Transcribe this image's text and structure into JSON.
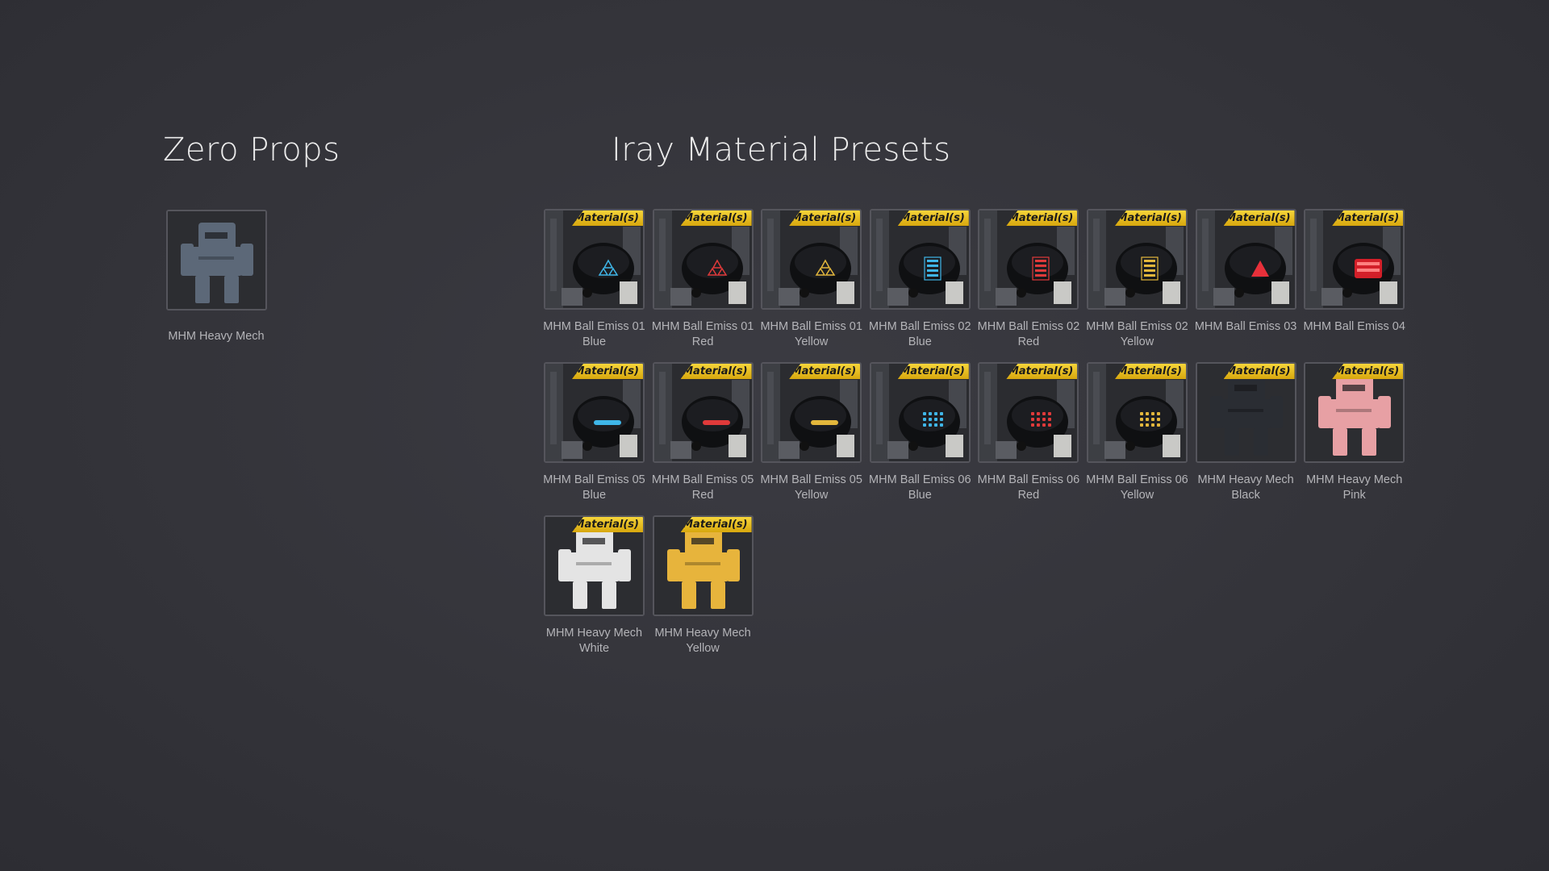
{
  "zero_props": {
    "title": "Zero Props",
    "items": [
      {
        "label": "MHM Heavy Mech",
        "icon": "heavy-mech-icon"
      }
    ]
  },
  "iray_presets": {
    "title": "Iray Material Presets",
    "badge": "Material(s)",
    "items": [
      {
        "label": "MHM Ball Emiss 01 Blue",
        "icon": "ball-emiss-01-icon",
        "accent": "#3fb6e8"
      },
      {
        "label": "MHM Ball Emiss 01 Red",
        "icon": "ball-emiss-01-icon",
        "accent": "#e03a3a"
      },
      {
        "label": "MHM Ball Emiss 01 Yellow",
        "icon": "ball-emiss-01-icon",
        "accent": "#e3b73c"
      },
      {
        "label": "MHM Ball Emiss 02 Blue",
        "icon": "ball-emiss-02-icon",
        "accent": "#3fb6e8"
      },
      {
        "label": "MHM Ball Emiss 02 Red",
        "icon": "ball-emiss-02-icon",
        "accent": "#e03a3a"
      },
      {
        "label": "MHM Ball Emiss 02 Yellow",
        "icon": "ball-emiss-02-icon",
        "accent": "#e3b73c"
      },
      {
        "label": "MHM Ball Emiss 03",
        "icon": "ball-emiss-03-icon",
        "accent": "#e8303a"
      },
      {
        "label": "MHM Ball Emiss 04",
        "icon": "ball-emiss-04-icon",
        "accent": "#e8202a"
      },
      {
        "label": "MHM Ball Emiss 05 Blue",
        "icon": "ball-emiss-05-icon",
        "accent": "#3fb6e8"
      },
      {
        "label": "MHM Ball Emiss 05 Red",
        "icon": "ball-emiss-05-icon",
        "accent": "#e03a3a"
      },
      {
        "label": "MHM Ball Emiss 05 Yellow",
        "icon": "ball-emiss-05-icon",
        "accent": "#e3b73c"
      },
      {
        "label": "MHM Ball Emiss 06 Blue",
        "icon": "ball-emiss-06-icon",
        "accent": "#3fb6e8"
      },
      {
        "label": "MHM Ball Emiss 06 Red",
        "icon": "ball-emiss-06-icon",
        "accent": "#e03a3a"
      },
      {
        "label": "MHM Ball Emiss 06 Yellow",
        "icon": "ball-emiss-06-icon",
        "accent": "#e3b73c"
      },
      {
        "label": "MHM Heavy Mech Black",
        "icon": "heavy-mech-icon",
        "accent": "#2a2d33"
      },
      {
        "label": "MHM Heavy Mech Pink",
        "icon": "heavy-mech-icon",
        "accent": "#e7a0a4"
      },
      {
        "label": "MHM Heavy Mech White",
        "icon": "heavy-mech-icon",
        "accent": "#e4e4e4"
      },
      {
        "label": "MHM Heavy Mech Yellow",
        "icon": "heavy-mech-icon",
        "accent": "#e7b43c"
      }
    ]
  }
}
